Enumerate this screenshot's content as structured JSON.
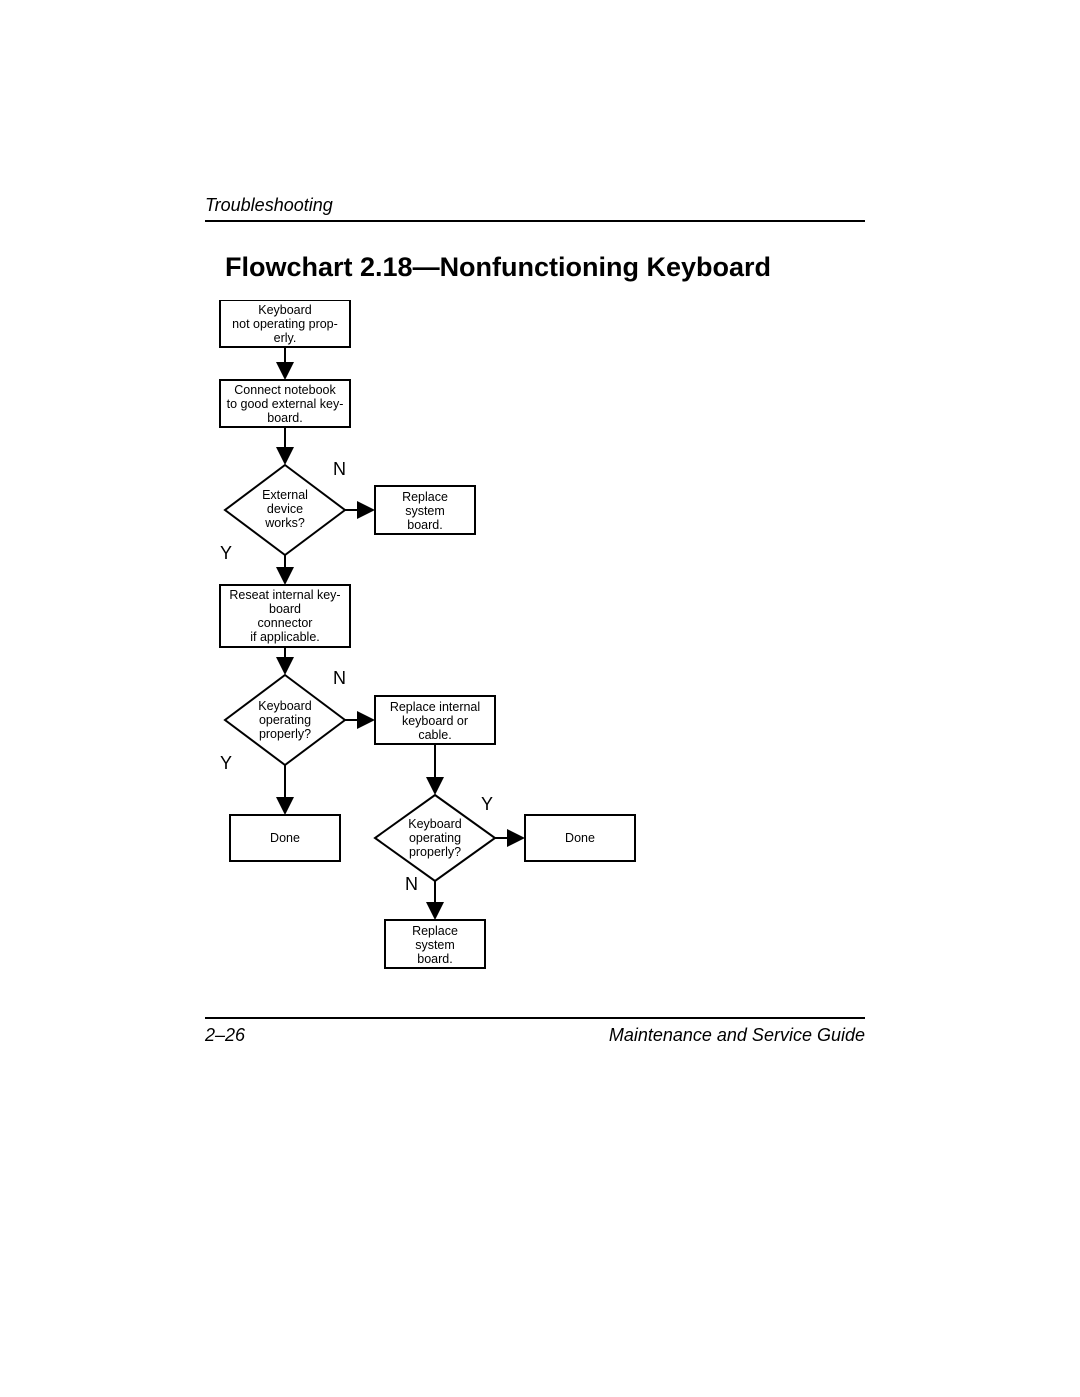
{
  "header": "Troubleshooting",
  "title": "Flowchart 2.18—Nonfunctioning Keyboard",
  "footer": {
    "left": "2–26",
    "right": "Maintenance and Service Guide"
  },
  "nodes": {
    "start": {
      "l1": "Keyboard",
      "l2": "not operating prop-",
      "l3": "erly."
    },
    "connect": {
      "l1": "Connect notebook",
      "l2": "to good external key-",
      "l3": "board."
    },
    "extworks": {
      "l1": "External",
      "l2": "device",
      "l3": "works?"
    },
    "replsys1": {
      "l1": "Replace",
      "l2": "system",
      "l3": "board."
    },
    "reseat": {
      "l1": "Reseat internal key-",
      "l2": "board",
      "l3": "connector",
      "l4": "if applicable."
    },
    "kbop1": {
      "l1": "Keyboard",
      "l2": "operating",
      "l3": "properly?"
    },
    "replint": {
      "l1": "Replace internal",
      "l2": "keyboard or",
      "l3": "cable."
    },
    "done1": "Done",
    "kbop2": {
      "l1": "Keyboard",
      "l2": "operating",
      "l3": "properly?"
    },
    "done2": "Done",
    "replsys2": {
      "l1": "Replace",
      "l2": "system",
      "l3": "board."
    }
  },
  "labels": {
    "Y": "Y",
    "N": "N"
  }
}
